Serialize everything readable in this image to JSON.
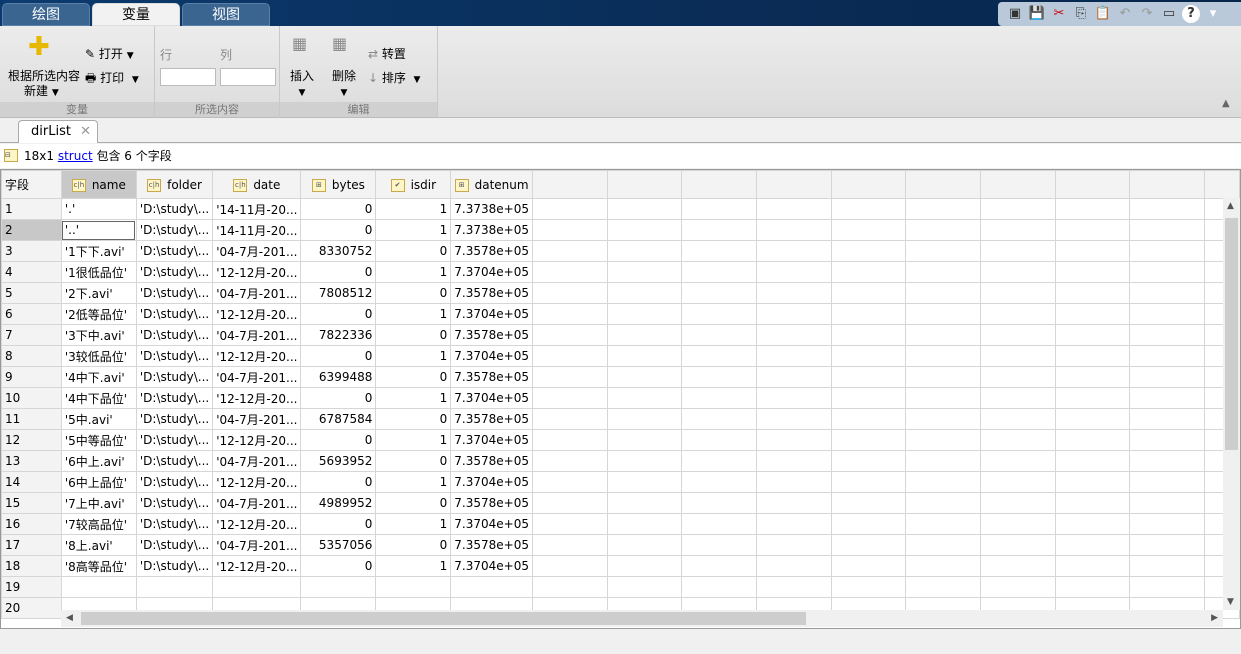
{
  "tabs": [
    "绘图",
    "变量",
    "视图"
  ],
  "active_tab": "变量",
  "quick_access": [
    "new-document-icon",
    "save-icon",
    "cut-icon",
    "copy-icon",
    "paste-icon",
    "undo-icon",
    "redo-icon",
    "window-layout-icon",
    "help-icon",
    "expand-icon"
  ],
  "ribbon": {
    "variable_group": {
      "new_from_selection": "根据所选内容",
      "new": "新建",
      "open": "打开",
      "print": "打印",
      "label": "变量"
    },
    "selection_group": {
      "row": "行",
      "column": "列",
      "row_value": "",
      "column_value": "",
      "label": "所选内容"
    },
    "edit_group": {
      "insert": "插入",
      "delete": "删除",
      "transpose": "转置",
      "sort": "排序",
      "label": "编辑"
    }
  },
  "doc_tab": "dirList",
  "info": {
    "size": "18x1",
    "type_link": "struct",
    "suffix": "包含 6 个字段"
  },
  "table": {
    "corner": "字段",
    "columns": [
      {
        "name": "name",
        "icon": "ch"
      },
      {
        "name": "folder",
        "icon": "ch"
      },
      {
        "name": "date",
        "icon": "ch"
      },
      {
        "name": "bytes",
        "icon": "grid"
      },
      {
        "name": "isdir",
        "icon": "check"
      },
      {
        "name": "datenum",
        "icon": "grid"
      }
    ],
    "rows": [
      [
        "'.'",
        "'D:\\study\\...",
        "'14-11月-20...",
        "0",
        "1",
        "7.3738e+05"
      ],
      [
        "'..'",
        "'D:\\study\\...",
        "'14-11月-20...",
        "0",
        "1",
        "7.3738e+05"
      ],
      [
        "'1下下.avi'",
        "'D:\\study\\...",
        "'04-7月-201...",
        "8330752",
        "0",
        "7.3578e+05"
      ],
      [
        "'1很低品位'",
        "'D:\\study\\...",
        "'12-12月-20...",
        "0",
        "1",
        "7.3704e+05"
      ],
      [
        "'2下.avi'",
        "'D:\\study\\...",
        "'04-7月-201...",
        "7808512",
        "0",
        "7.3578e+05"
      ],
      [
        "'2低等品位'",
        "'D:\\study\\...",
        "'12-12月-20...",
        "0",
        "1",
        "7.3704e+05"
      ],
      [
        "'3下中.avi'",
        "'D:\\study\\...",
        "'04-7月-201...",
        "7822336",
        "0",
        "7.3578e+05"
      ],
      [
        "'3较低品位'",
        "'D:\\study\\...",
        "'12-12月-20...",
        "0",
        "1",
        "7.3704e+05"
      ],
      [
        "'4中下.avi'",
        "'D:\\study\\...",
        "'04-7月-201...",
        "6399488",
        "0",
        "7.3578e+05"
      ],
      [
        "'4中下品位'",
        "'D:\\study\\...",
        "'12-12月-20...",
        "0",
        "1",
        "7.3704e+05"
      ],
      [
        "'5中.avi'",
        "'D:\\study\\...",
        "'04-7月-201...",
        "6787584",
        "0",
        "7.3578e+05"
      ],
      [
        "'5中等品位'",
        "'D:\\study\\...",
        "'12-12月-20...",
        "0",
        "1",
        "7.3704e+05"
      ],
      [
        "'6中上.avi'",
        "'D:\\study\\...",
        "'04-7月-201...",
        "5693952",
        "0",
        "7.3578e+05"
      ],
      [
        "'6中上品位'",
        "'D:\\study\\...",
        "'12-12月-20...",
        "0",
        "1",
        "7.3704e+05"
      ],
      [
        "'7上中.avi'",
        "'D:\\study\\...",
        "'04-7月-201...",
        "4989952",
        "0",
        "7.3578e+05"
      ],
      [
        "'7较高品位'",
        "'D:\\study\\...",
        "'12-12月-20...",
        "0",
        "1",
        "7.3704e+05"
      ],
      [
        "'8上.avi'",
        "'D:\\study\\...",
        "'04-7月-201...",
        "5357056",
        "0",
        "7.3578e+05"
      ],
      [
        "'8高等品位'",
        "'D:\\study\\...",
        "'12-12月-20...",
        "0",
        "1",
        "7.3704e+05"
      ]
    ],
    "row_count_visible": 20,
    "selected_row": 2,
    "selected_column": "name"
  }
}
